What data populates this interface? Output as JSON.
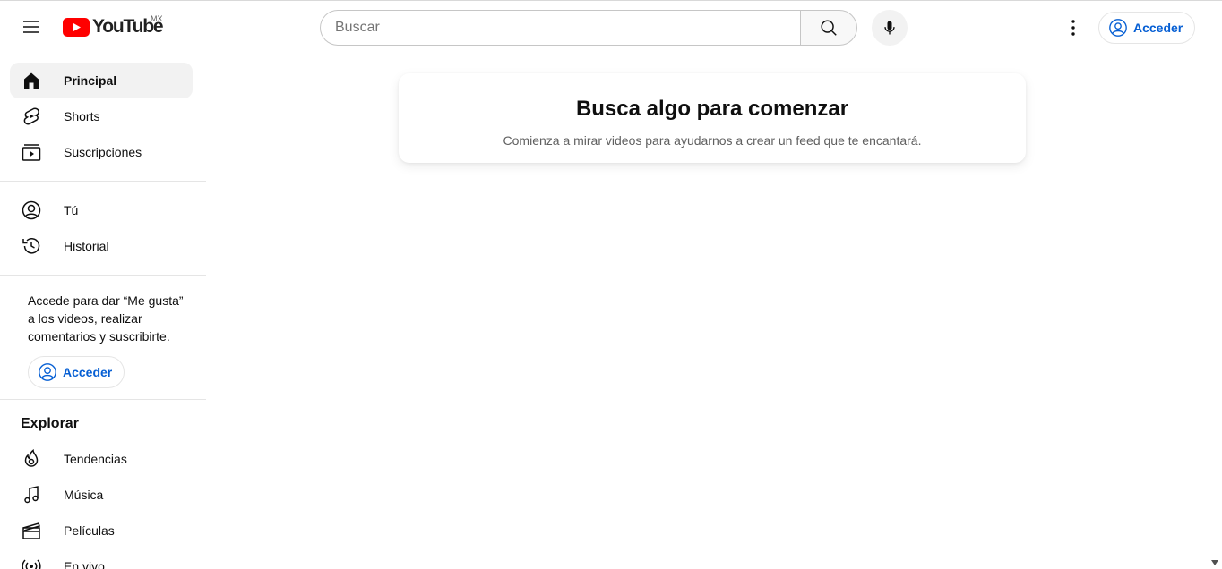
{
  "header": {
    "logo_text": "YouTube",
    "country_code": "MX",
    "search_placeholder": "Buscar",
    "signin_label": "Acceder"
  },
  "sidebar": {
    "main_items": [
      {
        "label": "Principal",
        "icon": "home-icon",
        "active": true
      },
      {
        "label": "Shorts",
        "icon": "shorts-icon"
      },
      {
        "label": "Suscripciones",
        "icon": "subscriptions-icon"
      }
    ],
    "you_items": [
      {
        "label": "Tú",
        "icon": "user-circle-icon"
      },
      {
        "label": "Historial",
        "icon": "history-icon"
      }
    ],
    "signin_promo": "Accede para dar “Me gusta” a los videos, realizar comentarios y suscribirte.",
    "signin_label": "Acceder",
    "explore_title": "Explorar",
    "explore_items": [
      {
        "label": "Tendencias",
        "icon": "trending-icon"
      },
      {
        "label": "Música",
        "icon": "music-icon"
      },
      {
        "label": "Películas",
        "icon": "movies-icon"
      },
      {
        "label": "En vivo",
        "icon": "live-icon"
      }
    ]
  },
  "main": {
    "title": "Busca algo para comenzar",
    "subtitle": "Comienza a mirar videos para ayudarnos a crear un feed que te encantará."
  },
  "colors": {
    "brand_red": "#ff0000",
    "link_blue": "#065fd4",
    "active_bg": "#f2f2f2"
  }
}
